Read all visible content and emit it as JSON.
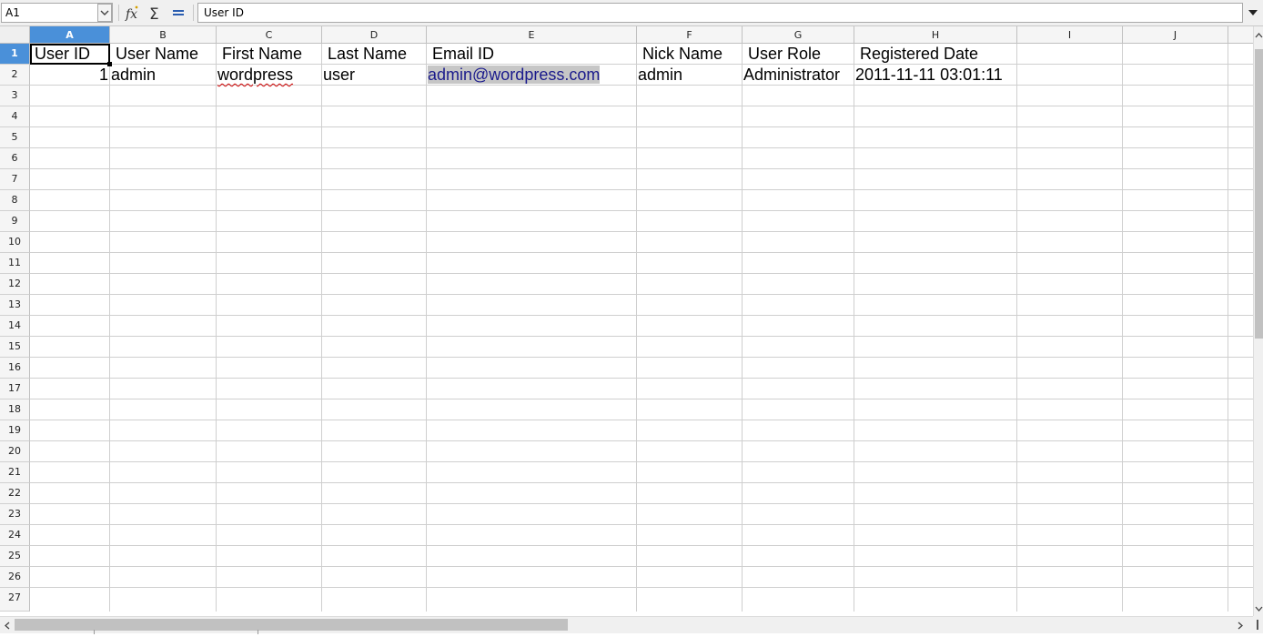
{
  "formula_bar": {
    "name_box": "A1",
    "formula": "User ID",
    "icons": [
      "function-wizard-icon",
      "sum-icon",
      "equals-icon"
    ]
  },
  "columns": [
    "A",
    "B",
    "C",
    "D",
    "E",
    "F",
    "G",
    "H",
    "I",
    "J"
  ],
  "rows": [
    "1",
    "2",
    "3",
    "4",
    "5",
    "6",
    "7",
    "8",
    "9",
    "10",
    "11",
    "12",
    "13",
    "14",
    "15",
    "16",
    "17",
    "18",
    "19",
    "20",
    "21",
    "22",
    "23",
    "24",
    "25",
    "26",
    "27"
  ],
  "selection": {
    "active_cell": "A1",
    "active_column": "A",
    "active_row": "1"
  },
  "sheet": {
    "header": {
      "A": "User ID",
      "B": "User Name",
      "C": "First Name",
      "D": "Last Name",
      "E": "Email ID",
      "F": "Nick Name",
      "G": "User Role",
      "H": "Registered Date"
    },
    "row2": {
      "A": "1",
      "B": "admin",
      "C": "wordpress",
      "D": "user",
      "E": "admin@wordpress.com",
      "F": "admin",
      "G": "Administrator",
      "H": "2011-11-11 03:01:11"
    }
  },
  "colors": {
    "selection_header": "#4a90d9",
    "hyperlink": "#1a1a8c",
    "spellcheck": "#d00000"
  }
}
